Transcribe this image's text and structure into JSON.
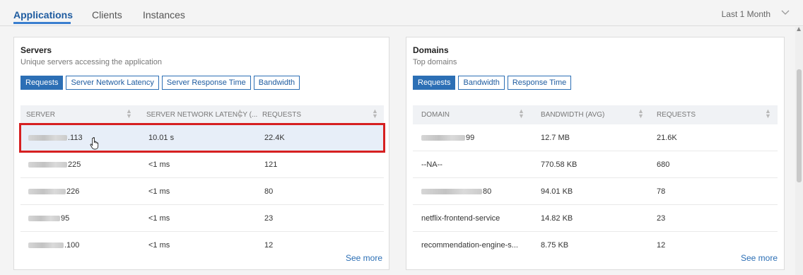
{
  "tabs": [
    {
      "label": "Applications",
      "active": true
    },
    {
      "label": "Clients",
      "active": false
    },
    {
      "label": "Instances",
      "active": false
    }
  ],
  "time_range": "Last 1 Month",
  "servers": {
    "title": "Servers",
    "subtitle": "Unique servers accessing the application",
    "buttons": [
      "Requests",
      "Server Network Latency",
      "Server Response Time",
      "Bandwidth"
    ],
    "columns": [
      "SERVER",
      "SERVER NETWORK LATENCY (...",
      "REQUESTS"
    ],
    "rows": [
      {
        "server": ".113",
        "latency": "10.01 s",
        "requests": "22.4K",
        "selected": true
      },
      {
        "server": "225",
        "latency": "<1 ms",
        "requests": "121"
      },
      {
        "server": "226",
        "latency": "<1 ms",
        "requests": "80"
      },
      {
        "server": "95",
        "latency": "<1 ms",
        "requests": "23"
      },
      {
        "server": ".100",
        "latency": "<1 ms",
        "requests": "12"
      }
    ],
    "see_more": "See more"
  },
  "domains": {
    "title": "Domains",
    "subtitle": "Top domains",
    "buttons": [
      "Requests",
      "Bandwidth",
      "Response Time"
    ],
    "columns": [
      "DOMAIN",
      "BANDWIDTH (AVG)",
      "REQUESTS"
    ],
    "rows": [
      {
        "domain": "99",
        "bandwidth": "12.7 MB",
        "requests": "21.6K"
      },
      {
        "domain": "--NA--",
        "bandwidth": "770.58 KB",
        "requests": "680"
      },
      {
        "domain": "80",
        "bandwidth": "94.01 KB",
        "requests": "78"
      },
      {
        "domain": "netflix-frontend-service",
        "bandwidth": "14.82 KB",
        "requests": "23"
      },
      {
        "domain": "recommendation-engine-s...",
        "bandwidth": "8.75 KB",
        "requests": "12"
      }
    ],
    "see_more": "See more"
  },
  "colors": {
    "accent": "#2c6fb5",
    "highlight_border": "#d62021"
  },
  "icons": [
    "chevron-down-icon",
    "sort-icon",
    "hand-cursor-icon",
    "scroll-up-icon"
  ]
}
